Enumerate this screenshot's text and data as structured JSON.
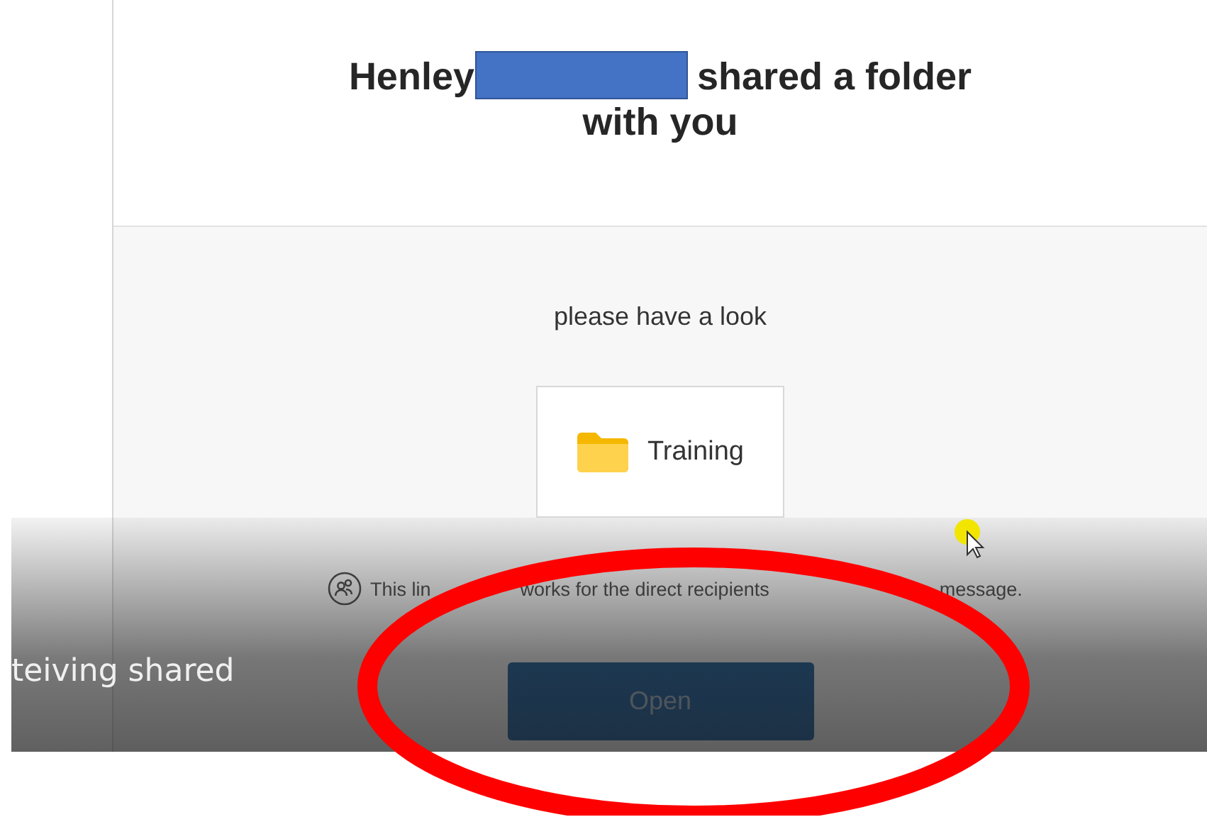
{
  "email": {
    "title_before": "Henley",
    "title_after": "shared a folder with you",
    "message": "please have a look",
    "folder": {
      "name": "Training"
    },
    "notice_parts": [
      "This lin",
      "works for the direct recipients",
      "message."
    ],
    "button": "Open"
  },
  "video": {
    "caption": "teiving shared"
  }
}
